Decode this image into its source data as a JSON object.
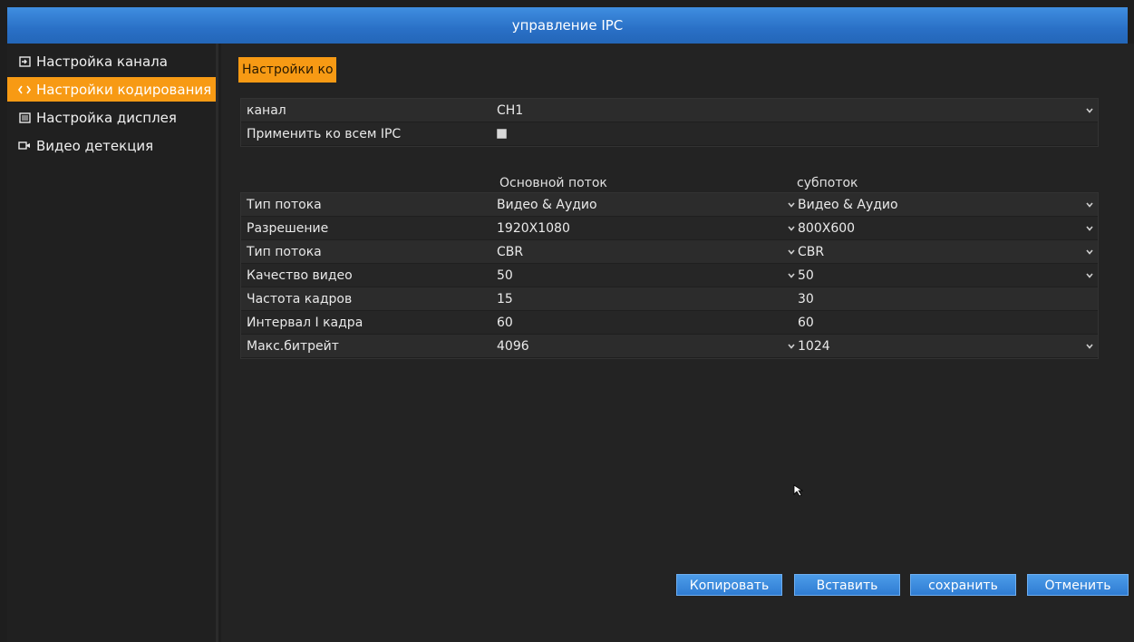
{
  "window": {
    "title": "управление IPC"
  },
  "sidebar": {
    "items": [
      {
        "label": "Настройка канала",
        "icon": "input-channel-icon",
        "active": false
      },
      {
        "label": "Настройки кодирования",
        "icon": "code-brackets-icon",
        "active": true
      },
      {
        "label": "Настройка дисплея",
        "icon": "display-settings-icon",
        "active": false
      },
      {
        "label": "Видео детекция",
        "icon": "video-camera-icon",
        "active": false
      }
    ]
  },
  "page": {
    "tab_label": "Настройки ко"
  },
  "channel": {
    "label": "канал",
    "value": "CH1",
    "apply_all_label": "Применить ко всем IPC",
    "apply_all_checked": false
  },
  "table": {
    "main_header": "Основной поток",
    "sub_header": "субпоток",
    "rows": [
      {
        "label": "Тип потока",
        "main": "Видео & Аудио",
        "sub": "Видео & Аудио"
      },
      {
        "label": "Разрешение",
        "main": "1920X1080",
        "sub": "800X600"
      },
      {
        "label": "Тип потока",
        "main": "CBR",
        "sub": "CBR"
      },
      {
        "label": "Качество видео",
        "main": "50",
        "sub": "50"
      },
      {
        "label": "Частота кадров",
        "main": "15",
        "sub": "30"
      },
      {
        "label": "Интервал I кадра",
        "main": "60",
        "sub": "60"
      },
      {
        "label": "Макс.битрейт",
        "main": "4096",
        "sub": "1024"
      }
    ]
  },
  "buttons": {
    "copy": "Копировать",
    "paste": "Вставить",
    "save": "сохранить",
    "cancel": "Отменить"
  },
  "colors": {
    "accent": "#f79a14",
    "titlebar": "#2a70c6",
    "button": "#2f7cd2"
  }
}
